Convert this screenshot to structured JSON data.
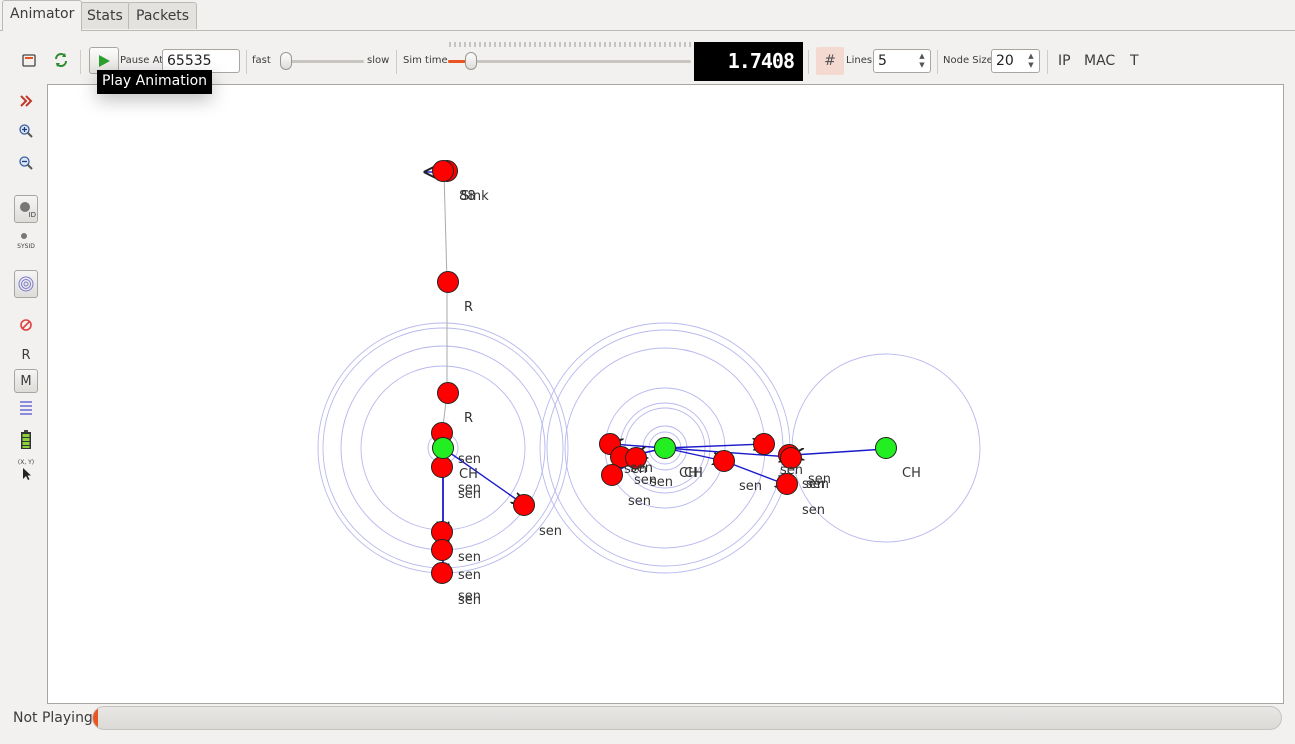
{
  "tabs": [
    {
      "label": "Animator",
      "active": true
    },
    {
      "label": "Stats",
      "active": false
    },
    {
      "label": "Packets",
      "active": false
    }
  ],
  "toolbar": {
    "play_icon": "play-icon",
    "pause_at_label": "Pause At",
    "pause_at_value": "65535",
    "fast_label": "fast",
    "slow_label": "slow",
    "speed_fraction": 0.0,
    "sim_time_label": "Sim time",
    "sim_time_fraction": 0.03,
    "sim_time_display": "1.7408",
    "grid_symbol": "#",
    "lines_label": "Lines",
    "lines_value": "5",
    "node_size_label": "Node Size",
    "node_size_value": "20",
    "ip_label": "IP",
    "mac_label": "MAC",
    "t_label": "T"
  },
  "tooltip": {
    "text": "Play Animation"
  },
  "left_tools": {
    "r_label": "R",
    "m_label": "M",
    "sysid_label": "SYSID",
    "id_label": "ID",
    "xy_label": "(X, Y)"
  },
  "colors": {
    "node_sensor": "#ff0000",
    "node_cluster_head": "#22ee22",
    "packet_arrow": "#1a1acc",
    "range_circle": "#b8b8ee",
    "accent": "#e95420"
  },
  "canvas": {
    "node_labels": {
      "sink": "Sink",
      "sink_overlap": "88",
      "relay": "R",
      "sensor": "sen",
      "cluster_head": "CH",
      "cluster_head_overlap": "CH"
    }
  },
  "status": {
    "text": "Not Playing",
    "progress_fraction": 0.004
  }
}
